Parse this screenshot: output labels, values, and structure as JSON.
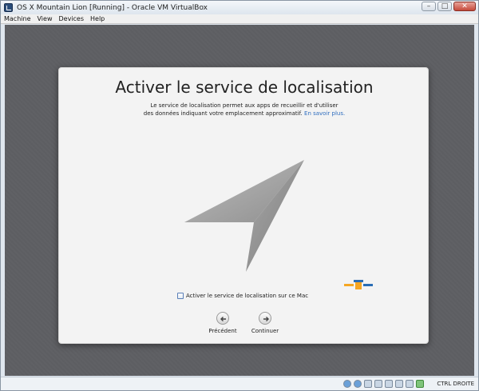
{
  "window": {
    "title": "OS X Mountain Lion [Running] - Oracle VM VirtualBox",
    "minimize_glyph": "–",
    "maximize_glyph": "□",
    "close_glyph": "✕"
  },
  "menu": {
    "items": [
      "Machine",
      "View",
      "Devices",
      "Help"
    ]
  },
  "dialog": {
    "title": "Activer le service de localisation",
    "description_line1": "Le service de localisation permet aux apps de recueillir et d'utiliser",
    "description_line2": "des données indiquant votre emplacement approximatif.",
    "learn_more_link": "En savoir plus.",
    "checkbox_label": "Activer le service de localisation sur ce Mac",
    "checkbox_checked": false,
    "back_button_label": "Précédent",
    "continue_button_label": "Continuer"
  },
  "icons": {
    "location": "location-arrow-icon",
    "back": "arrow-left-circle-icon",
    "forward": "arrow-right-circle-icon"
  },
  "statusbar": {
    "host_key": "CTRL DROITE"
  },
  "colors": {
    "link": "#2d6cbe",
    "close_button": "#c5493a"
  }
}
